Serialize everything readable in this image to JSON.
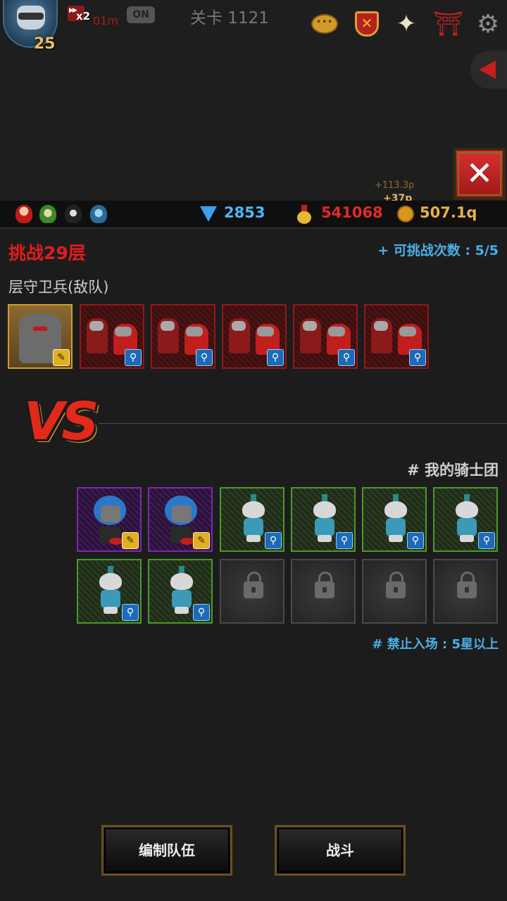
{
  "hud": {
    "level": "25",
    "speed_multiplier": "x2",
    "speed_time": "01m",
    "speed_toggle": "ON",
    "stage": "关卡 1121",
    "floating_text_a": "+113.3p",
    "floating_text_b": "+37p"
  },
  "currency": {
    "gems": "2853",
    "medals": "541068",
    "gold": "507.1q"
  },
  "challenge": {
    "title": "挑战29层",
    "attempts": "+ 可挑战次数 : 5/5",
    "guard_label": "层守卫兵(敌队)"
  },
  "vs_label": "VS",
  "team": {
    "title": "# 我的骑士团",
    "restriction": "# 禁止入场 : 5星以上"
  },
  "buttons": {
    "edit_team": "编制队伍",
    "battle": "战斗"
  },
  "icons": {
    "chat": "chat-bubble-icon",
    "guild": "guild-shield-icon",
    "angel": "angel-icon",
    "arch": "arch-gate-icon",
    "settings": "gear-icon",
    "close": "close-icon",
    "gem": "gem-icon",
    "medal": "medal-icon",
    "gold": "gold-coin-icon",
    "badge_search": "magnifier-icon",
    "badge_sword": "sword-icon",
    "lock": "lock-icon"
  },
  "colors": {
    "accent_red": "#e21c1c",
    "accent_blue": "#4ab0e8",
    "gold_text": "#e8b04a",
    "tile_gold": "#d89a2a",
    "tile_red": "#8e1a1a",
    "tile_purple": "#7a2aa8",
    "tile_green": "#4a9a2a"
  }
}
